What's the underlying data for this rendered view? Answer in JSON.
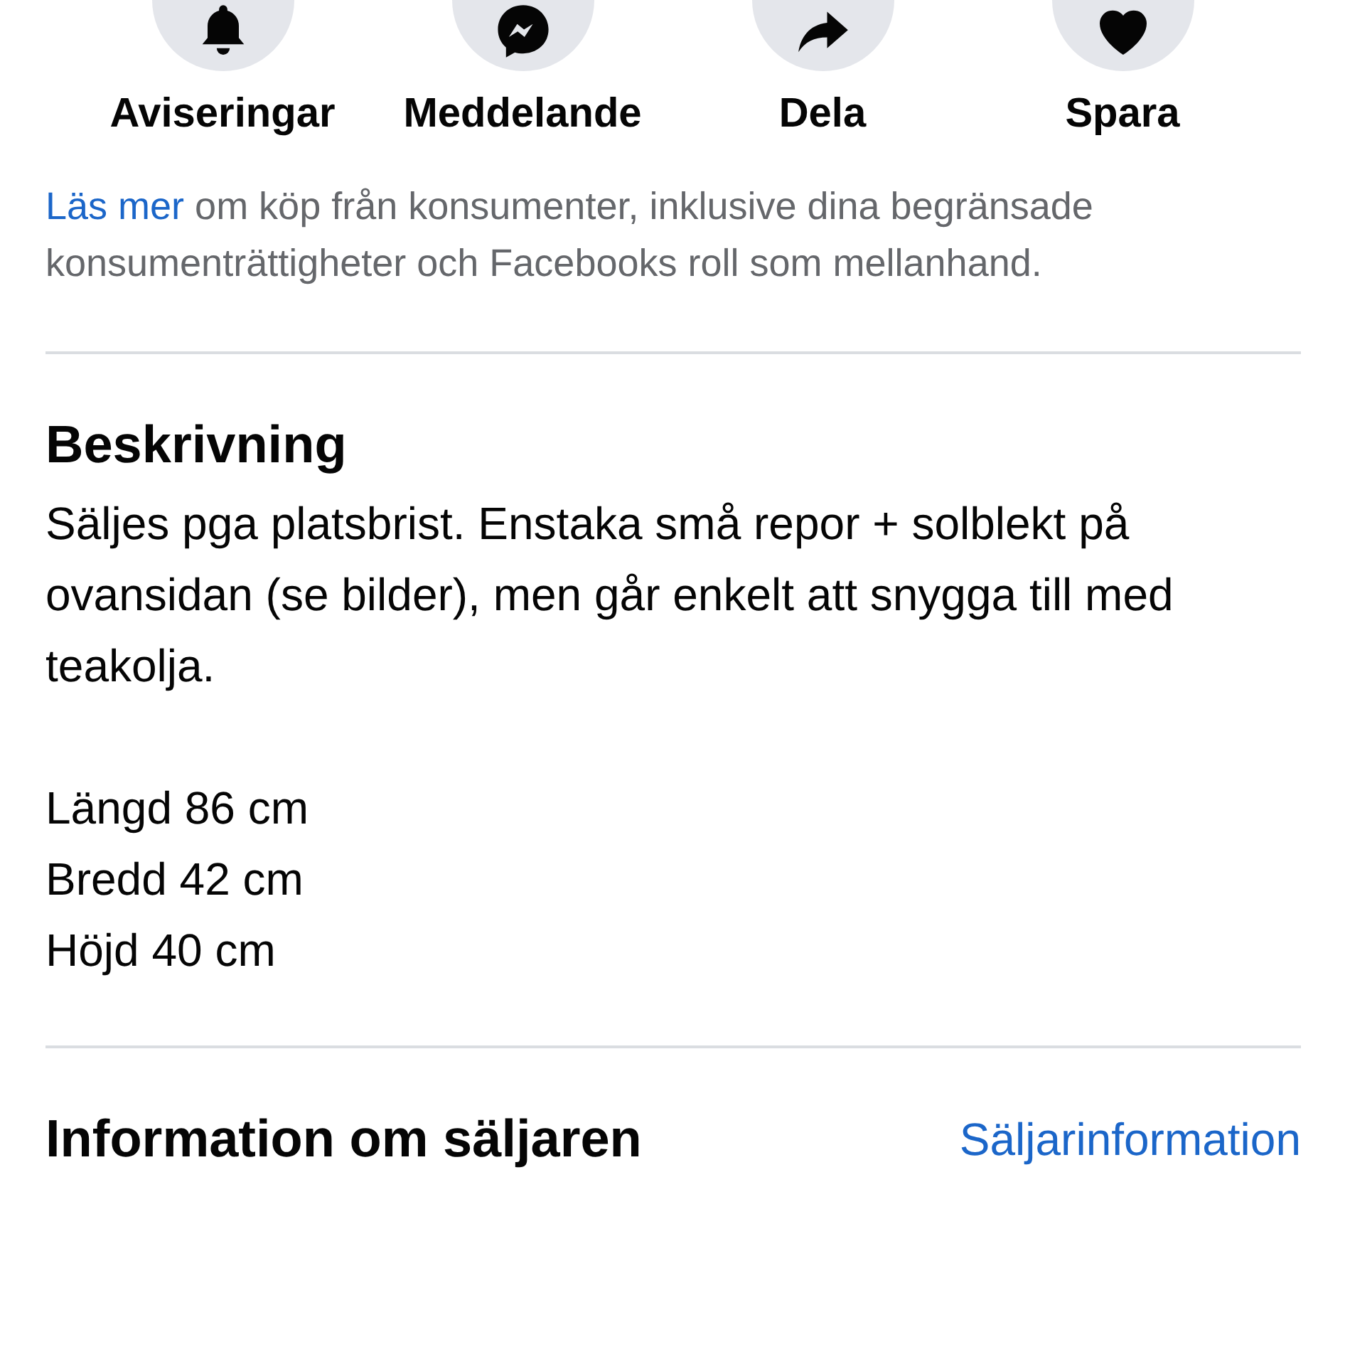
{
  "actions": [
    {
      "kind": "bell",
      "label": "Aviseringar"
    },
    {
      "kind": "messenger",
      "label": "Meddelande"
    },
    {
      "kind": "share",
      "label": "Dela"
    },
    {
      "kind": "heart",
      "label": "Spara"
    }
  ],
  "notice": {
    "link": "Läs mer",
    "text": " om köp från konsumenter, inklusive dina begränsade konsumenträttigheter och Facebooks roll som mellanhand."
  },
  "description": {
    "title": "Beskrivning",
    "paragraphs": [
      "Säljes pga platsbrist. Enstaka små repor + solblekt på ovansidan (se bilder), men går enkelt att snygga till med teakolja."
    ],
    "lines": [
      "Längd 86 cm",
      "Bredd 42 cm",
      "Höjd 40 cm"
    ]
  },
  "seller": {
    "title": "Information om säljaren",
    "link": "Säljarinformation"
  }
}
